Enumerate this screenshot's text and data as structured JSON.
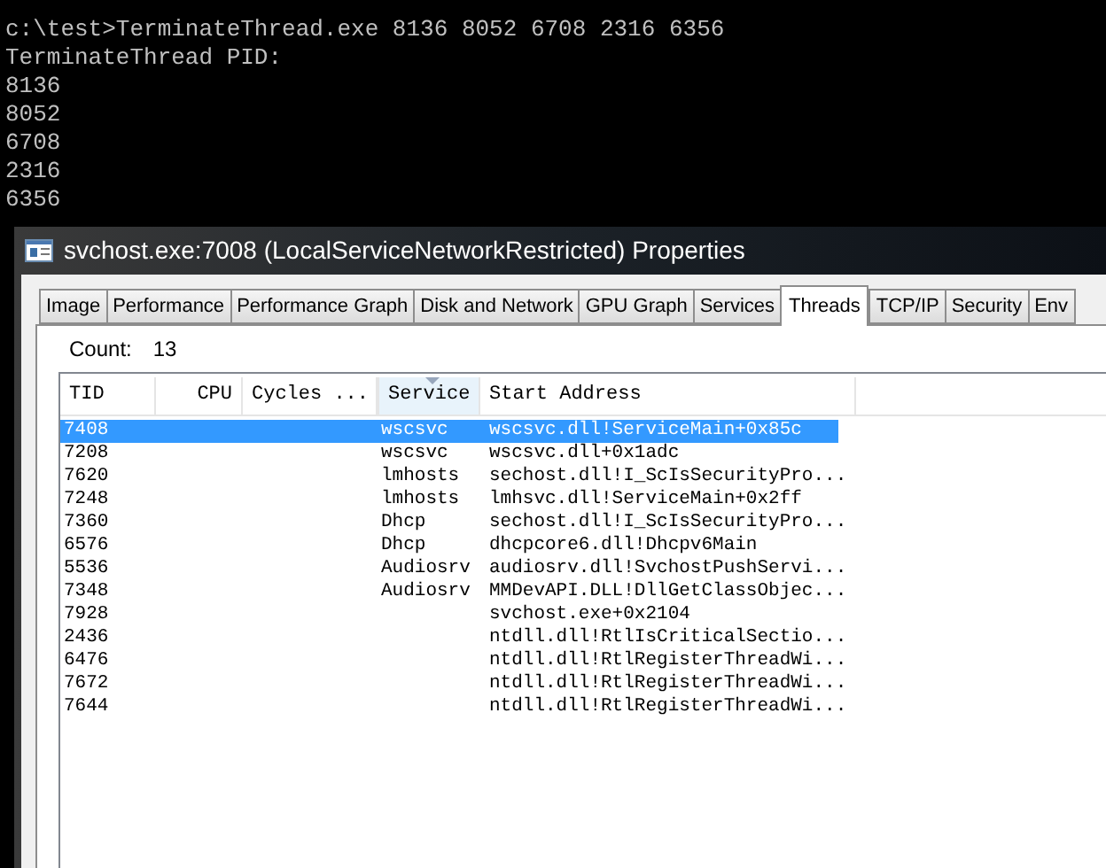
{
  "console": {
    "lines": [
      "c:\\test>TerminateThread.exe 8136 8052 6708 2316 6356",
      "TerminateThread PID:",
      "8136",
      "8052",
      "6708",
      "2316",
      "6356"
    ]
  },
  "window": {
    "title": "svchost.exe:7008 (LocalServiceNetworkRestricted) Properties"
  },
  "tabs": [
    {
      "label": "Image",
      "selected": false
    },
    {
      "label": "Performance",
      "selected": false
    },
    {
      "label": "Performance Graph",
      "selected": false
    },
    {
      "label": "Disk and Network",
      "selected": false
    },
    {
      "label": "GPU Graph",
      "selected": false
    },
    {
      "label": "Services",
      "selected": false
    },
    {
      "label": "Threads",
      "selected": true
    },
    {
      "label": "TCP/IP",
      "selected": false
    },
    {
      "label": "Security",
      "selected": false
    },
    {
      "label": "Env",
      "selected": false
    }
  ],
  "count": {
    "label": "Count:",
    "value": "13"
  },
  "table": {
    "columns": [
      {
        "label": "TID",
        "sorted": false
      },
      {
        "label": "CPU",
        "sorted": false
      },
      {
        "label": "Cycles ...",
        "sorted": false
      },
      {
        "label": "Service",
        "sorted": true
      },
      {
        "label": "Start Address",
        "sorted": false
      }
    ],
    "rows": [
      {
        "tid": "7408",
        "service": "wscsvc",
        "start_address": "wscsvc.dll!ServiceMain+0x85c",
        "selected": true
      },
      {
        "tid": "7208",
        "service": "wscsvc",
        "start_address": "wscsvc.dll+0x1adc",
        "selected": false
      },
      {
        "tid": "7620",
        "service": "lmhosts",
        "start_address": "sechost.dll!I_ScIsSecurityPro...",
        "selected": false
      },
      {
        "tid": "7248",
        "service": "lmhosts",
        "start_address": "lmhsvc.dll!ServiceMain+0x2ff",
        "selected": false
      },
      {
        "tid": "7360",
        "service": "Dhcp",
        "start_address": "sechost.dll!I_ScIsSecurityPro...",
        "selected": false
      },
      {
        "tid": "6576",
        "service": "Dhcp",
        "start_address": "dhcpcore6.dll!Dhcpv6Main",
        "selected": false
      },
      {
        "tid": "5536",
        "service": "Audiosrv",
        "start_address": "audiosrv.dll!SvchostPushServi...",
        "selected": false
      },
      {
        "tid": "7348",
        "service": "Audiosrv",
        "start_address": "MMDevAPI.DLL!DllGetClassObjec...",
        "selected": false
      },
      {
        "tid": "7928",
        "start_address": "svchost.exe+0x2104",
        "selected": false
      },
      {
        "tid": "2436",
        "start_address": "ntdll.dll!RtlIsCriticalSectio...",
        "selected": false
      },
      {
        "tid": "6476",
        "start_address": "ntdll.dll!RtlRegisterThreadWi...",
        "selected": false
      },
      {
        "tid": "7672",
        "start_address": "ntdll.dll!RtlRegisterThreadWi...",
        "selected": false
      },
      {
        "tid": "7644",
        "start_address": "ntdll.dll!RtlRegisterThreadWi...",
        "selected": false
      }
    ]
  }
}
